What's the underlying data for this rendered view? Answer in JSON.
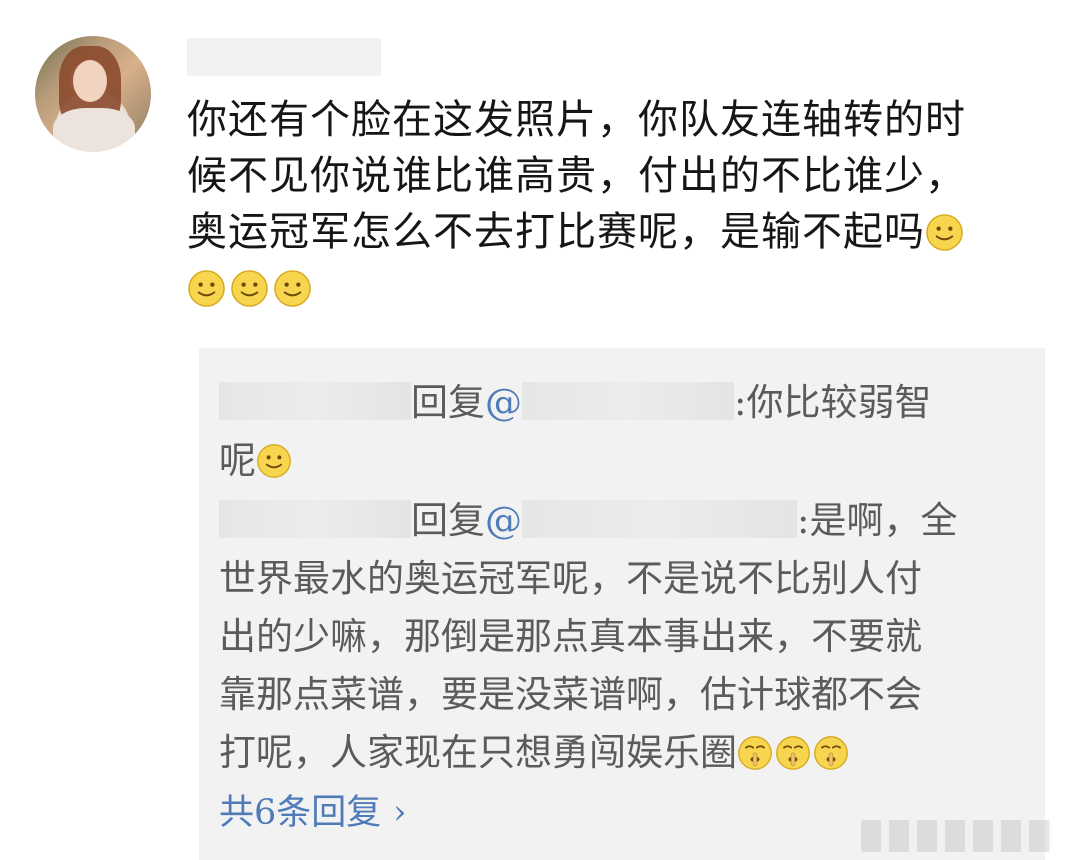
{
  "comment": {
    "text_line_1": "你还有个脸在这发照片，你队友连轴转的时",
    "text_line_2": "候不见你说谁比谁高贵，付出的不比谁少，",
    "text_line_3": "奥运冠军怎么不去打比赛呢，是输不起吗"
  },
  "replies": [
    {
      "reply_word": "回复",
      "mention_prefix": "@",
      "text": ":你比较弱智",
      "text_cont": "呢"
    },
    {
      "reply_word": "回复",
      "mention_prefix": "@",
      "text": ":是啊，全",
      "lines": [
        "世界最水的奥运冠军呢，不是说不比别人付",
        "出的少嘛，那倒是那点真本事出来，不要就",
        "靠那点菜谱，要是没菜谱啊，估计球都不会",
        "打呢，人家现在只想勇闯娱乐圈"
      ]
    }
  ],
  "view_more": {
    "label": "共6条回复",
    "chevron": "›"
  },
  "colors": {
    "accent": "#4f7bb8",
    "comment_text": "#161616",
    "reply_text": "#5b5b5b",
    "reply_bg": "#f2f2f2"
  },
  "icons": {
    "smile_emoji": "smile-emoji-icon",
    "shush_emoji": "shush-emoji-icon",
    "chevron": "chevron-right-icon"
  }
}
